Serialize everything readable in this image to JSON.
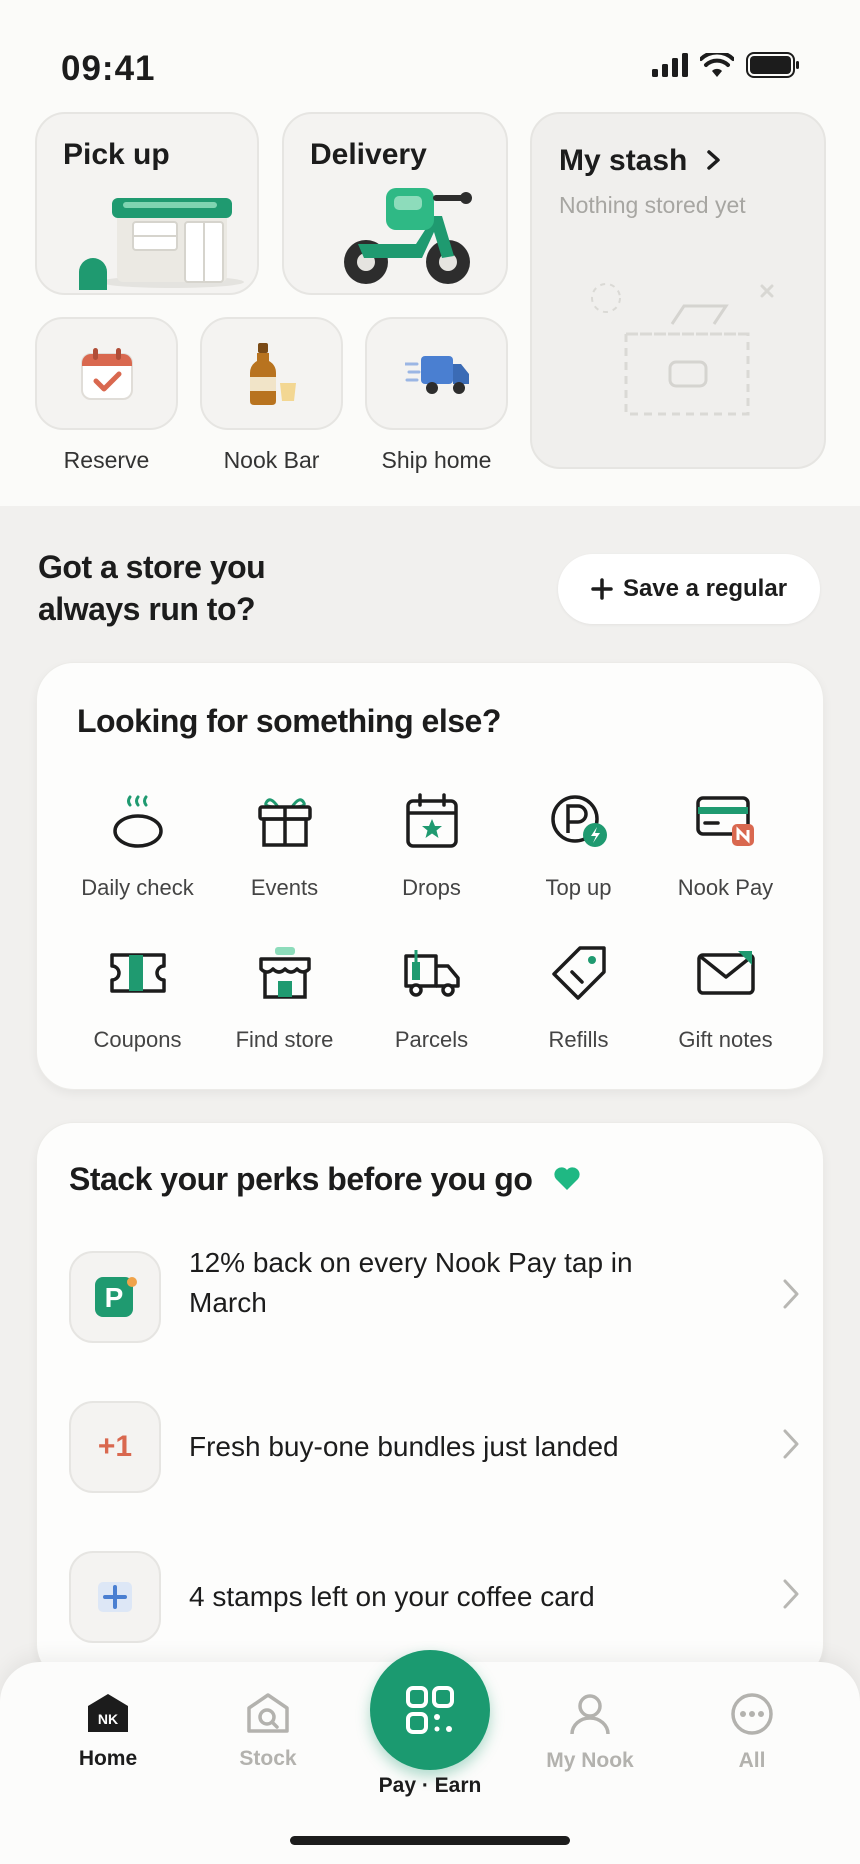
{
  "status": {
    "time": "09:41"
  },
  "services": {
    "pickup": "Pick up",
    "delivery": "Delivery",
    "reserve": "Reserve",
    "nook_bar": "Nook Bar",
    "ship_home": "Ship home"
  },
  "stash": {
    "title": "My stash",
    "subtitle": "Nothing stored yet"
  },
  "regular": {
    "question_line1": "Got a store you",
    "question_line2": "always run to?",
    "button_label": "Save a regular"
  },
  "explore": {
    "title": "Looking for something else?",
    "items": [
      {
        "label": "Daily check",
        "icon": "steam-bowl-icon"
      },
      {
        "label": "Events",
        "icon": "gift-icon"
      },
      {
        "label": "Drops",
        "icon": "calendar-star-icon"
      },
      {
        "label": "Top up",
        "icon": "points-charge-icon"
      },
      {
        "label": "Nook Pay",
        "icon": "card-n-icon"
      },
      {
        "label": "Coupons",
        "icon": "ticket-icon"
      },
      {
        "label": "Find store",
        "icon": "storefront-icon"
      },
      {
        "label": "Parcels",
        "icon": "delivery-truck-icon"
      },
      {
        "label": "Refills",
        "icon": "tag-icon"
      },
      {
        "label": "Gift notes",
        "icon": "envelope-icon"
      }
    ]
  },
  "perks": {
    "title": "Stack your perks before you go",
    "items": [
      {
        "line1": "12% back on every Nook Pay tap in",
        "line2": "March",
        "icon_text": "P"
      },
      {
        "line1": "Fresh buy-one bundles just landed",
        "line2": "",
        "icon_text": "+1"
      },
      {
        "line1": "4 stamps left on your coffee card",
        "line2": "",
        "icon_text": "+"
      }
    ]
  },
  "tabbar": {
    "home": "Home",
    "home_logo": "NK",
    "stock": "Stock",
    "pay": "Pay · Earn",
    "mynook": "My Nook",
    "all": "All"
  },
  "colors": {
    "brand_green": "#1b9a70",
    "accent_coral": "#d9684f",
    "accent_blue": "#4a7fd1"
  }
}
